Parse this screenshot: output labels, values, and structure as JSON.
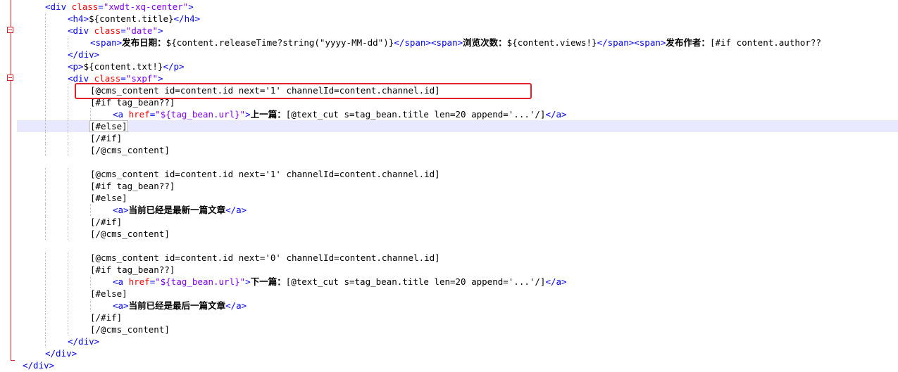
{
  "editor": {
    "current_line_index": 10,
    "colors": {
      "tag": "#0000ff",
      "attribute": "#ff0000",
      "string": "#8000ff",
      "text": "#000000",
      "current_line_bg": "#e8e8ff",
      "fold_marker": "#e0202b",
      "annotation_box": "#e0202b"
    },
    "lines": [
      {
        "indent": 1,
        "parts": [
          {
            "t": "tag",
            "v": "<div "
          },
          {
            "t": "attr",
            "v": "class"
          },
          {
            "t": "tag",
            "v": "="
          },
          {
            "t": "str",
            "v": "\"xwdt-xq-center\""
          },
          {
            "t": "tag",
            "v": ">"
          }
        ]
      },
      {
        "indent": 2,
        "parts": [
          {
            "t": "tag",
            "v": "<h4>"
          },
          {
            "t": "text",
            "v": "${content.title}"
          },
          {
            "t": "tag",
            "v": "</h4>"
          }
        ]
      },
      {
        "indent": 2,
        "parts": [
          {
            "t": "tag",
            "v": "<div "
          },
          {
            "t": "attr",
            "v": "class"
          },
          {
            "t": "tag",
            "v": "="
          },
          {
            "t": "str",
            "v": "\"date\""
          },
          {
            "t": "tag",
            "v": ">"
          }
        ]
      },
      {
        "indent": 3,
        "parts": [
          {
            "t": "tag",
            "v": "<span>"
          },
          {
            "t": "cn",
            "v": "发布日期："
          },
          {
            "t": "text",
            "v": "${content.releaseTime?string(\"yyyy-MM-dd\")}"
          },
          {
            "t": "tag",
            "v": "</span><span>"
          },
          {
            "t": "cn",
            "v": "浏览次数："
          },
          {
            "t": "text",
            "v": "${content.views!}"
          },
          {
            "t": "tag",
            "v": "</span><span>"
          },
          {
            "t": "cn",
            "v": "发布作者："
          },
          {
            "t": "text",
            "v": "[#if content.author??"
          }
        ]
      },
      {
        "indent": 2,
        "parts": [
          {
            "t": "tag",
            "v": "</div>"
          }
        ]
      },
      {
        "indent": 2,
        "parts": [
          {
            "t": "tag",
            "v": "<p>"
          },
          {
            "t": "text",
            "v": "${content.txt!}"
          },
          {
            "t": "tag",
            "v": "</p>"
          }
        ]
      },
      {
        "indent": 2,
        "parts": [
          {
            "t": "tag",
            "v": "<div "
          },
          {
            "t": "attr",
            "v": "class"
          },
          {
            "t": "tag",
            "v": "="
          },
          {
            "t": "str",
            "v": "\"sxpf\""
          },
          {
            "t": "tag",
            "v": ">"
          }
        ]
      },
      {
        "indent": 3,
        "parts": [
          {
            "t": "text",
            "v": "[@cms_content id=content.id next='1' channelId=content.channel.id]"
          }
        ]
      },
      {
        "indent": 3,
        "parts": [
          {
            "t": "text",
            "v": "[#if tag_bean??]"
          }
        ]
      },
      {
        "indent": 4,
        "parts": [
          {
            "t": "tag",
            "v": "<a "
          },
          {
            "t": "attr",
            "v": "href"
          },
          {
            "t": "tag",
            "v": "="
          },
          {
            "t": "str",
            "v": "\"${tag_bean.url}\""
          },
          {
            "t": "tag",
            "v": ">"
          },
          {
            "t": "cn",
            "v": "上一篇："
          },
          {
            "t": "text",
            "v": "[@text_cut s=tag_bean.title len=20 append='...'/]"
          },
          {
            "t": "tag",
            "v": "</a>"
          }
        ]
      },
      {
        "indent": 3,
        "parts": [
          {
            "t": "hl",
            "v": "[#else]"
          }
        ]
      },
      {
        "indent": 3,
        "parts": [
          {
            "t": "text",
            "v": "[/#if]"
          }
        ]
      },
      {
        "indent": 3,
        "parts": [
          {
            "t": "text",
            "v": "[/@cms_content]"
          }
        ]
      },
      {
        "indent": 0,
        "parts": []
      },
      {
        "indent": 3,
        "parts": [
          {
            "t": "text",
            "v": "[@cms_content id=content.id next='1' channelId=content.channel.id]"
          }
        ]
      },
      {
        "indent": 3,
        "parts": [
          {
            "t": "text",
            "v": "[#if tag_bean??]"
          }
        ]
      },
      {
        "indent": 3,
        "parts": [
          {
            "t": "text",
            "v": "[#else]"
          }
        ]
      },
      {
        "indent": 4,
        "parts": [
          {
            "t": "tag",
            "v": "<a>"
          },
          {
            "t": "cn",
            "v": "当前已经是最新一篇文章"
          },
          {
            "t": "tag",
            "v": "</a>"
          }
        ]
      },
      {
        "indent": 3,
        "parts": [
          {
            "t": "text",
            "v": "[/#if]"
          }
        ]
      },
      {
        "indent": 3,
        "parts": [
          {
            "t": "text",
            "v": "[/@cms_content]"
          }
        ]
      },
      {
        "indent": 0,
        "parts": []
      },
      {
        "indent": 3,
        "parts": [
          {
            "t": "text",
            "v": "[@cms_content id=content.id next='0' channelId=content.channel.id]"
          }
        ]
      },
      {
        "indent": 3,
        "parts": [
          {
            "t": "text",
            "v": "[#if tag_bean??]"
          }
        ]
      },
      {
        "indent": 4,
        "parts": [
          {
            "t": "tag",
            "v": "<a "
          },
          {
            "t": "attr",
            "v": "href"
          },
          {
            "t": "tag",
            "v": "="
          },
          {
            "t": "str",
            "v": "\"${tag_bean.url}\""
          },
          {
            "t": "tag",
            "v": ">"
          },
          {
            "t": "cn",
            "v": "下一篇："
          },
          {
            "t": "text",
            "v": "[@text_cut s=tag_bean.title len=20 append='...'/]"
          },
          {
            "t": "tag",
            "v": "</a>"
          }
        ]
      },
      {
        "indent": 3,
        "parts": [
          {
            "t": "text",
            "v": "[#else]"
          }
        ]
      },
      {
        "indent": 4,
        "parts": [
          {
            "t": "tag",
            "v": "<a>"
          },
          {
            "t": "cn",
            "v": "当前已经是最后一篇文章"
          },
          {
            "t": "tag",
            "v": "</a>"
          }
        ]
      },
      {
        "indent": 3,
        "parts": [
          {
            "t": "text",
            "v": "[/#if]"
          }
        ]
      },
      {
        "indent": 3,
        "parts": [
          {
            "t": "text",
            "v": "[/@cms_content]"
          }
        ]
      },
      {
        "indent": 2,
        "parts": [
          {
            "t": "tag",
            "v": "</div>"
          }
        ]
      },
      {
        "indent": 1,
        "parts": [
          {
            "t": "tag",
            "v": "</div>"
          }
        ]
      },
      {
        "indent": 0,
        "parts": [
          {
            "t": "tag",
            "v": "</div>"
          }
        ]
      }
    ]
  }
}
